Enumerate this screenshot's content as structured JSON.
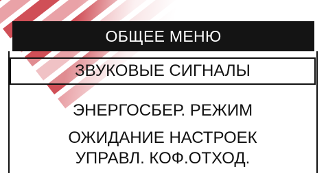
{
  "header": {
    "title": "ОБЩЕЕ МЕНЮ"
  },
  "menu": {
    "selected_index": 0,
    "items": [
      {
        "label": "ЗВУКОВЫЕ СИГНАЛЫ"
      },
      {
        "label": "ЭНЕРГОСБЕР. РЕЖИМ"
      },
      {
        "label": "ОЖИДАНИЕ НАСТРОЕК"
      },
      {
        "label": "УПРАВЛ. КОФ.ОТХОД."
      }
    ]
  },
  "colors": {
    "header_background": "#141414",
    "header_text": "#ffffff",
    "item_text": "#111111",
    "watermark": "#c8303a"
  }
}
